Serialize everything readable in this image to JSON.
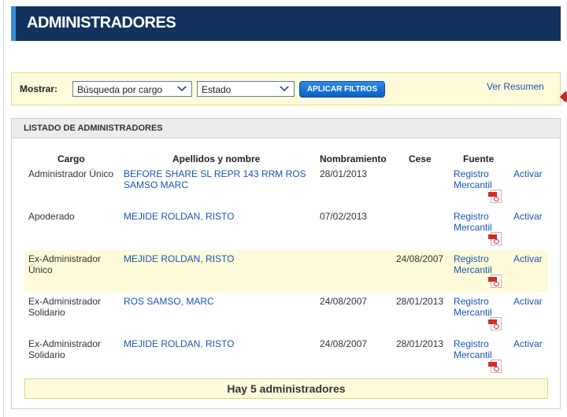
{
  "header": {
    "title": "ADMINISTRADORES"
  },
  "filters": {
    "label": "Mostrar:",
    "select_cargo": "Búsqueda por cargo",
    "select_estado": "Estado",
    "apply_label": "APLICAR FILTROS",
    "resumen_link": "Ver Resumen"
  },
  "panel": {
    "title": "LISTADO DE ADMINISTRADORES",
    "columns": [
      "Cargo",
      "Apellidos y nombre",
      "Nombramiento",
      "Cese",
      "Fuente"
    ],
    "rows": [
      {
        "cargo": "Administrador Único",
        "nombre": "BEFORE SHARE SL REPR 143 RRM ROS SAMSO MARC",
        "nombramiento": "28/01/2013",
        "cese": "",
        "fuente": "Registro Mercantil",
        "accion": "Activar",
        "highlight": false
      },
      {
        "cargo": "Apoderado",
        "nombre": "MEJIDE ROLDAN, RISTO",
        "nombramiento": "07/02/2013",
        "cese": "",
        "fuente": "Registro Mercantil",
        "accion": "Activar",
        "highlight": false
      },
      {
        "cargo": "Ex-Administrador Único",
        "nombre": "MEJIDE ROLDAN, RISTO",
        "nombramiento": "",
        "cese": "24/08/2007",
        "fuente": "Registro Mercantil",
        "accion": "Activar",
        "highlight": true
      },
      {
        "cargo": "Ex-Administrador Solidario",
        "nombre": "ROS SAMSO, MARC",
        "nombramiento": "24/08/2007",
        "cese": "28/01/2013",
        "fuente": "Registro Mercantil",
        "accion": "Activar",
        "highlight": false
      },
      {
        "cargo": "Ex-Administrador Solidario",
        "nombre": "MEJIDE ROLDAN, RISTO",
        "nombramiento": "24/08/2007",
        "cese": "28/01/2013",
        "fuente": "Registro Mercantil",
        "accion": "Activar",
        "highlight": false
      }
    ],
    "footer": "Hay 5 administradores"
  },
  "colors": {
    "header_bg": "#13335e",
    "accent": "#3a8fd6",
    "link": "#1a55b5",
    "highlight": "#fdfbd9",
    "pdf_red": "#d42b2b"
  },
  "icons": [
    "chevron-down-icon",
    "pdf-icon"
  ]
}
